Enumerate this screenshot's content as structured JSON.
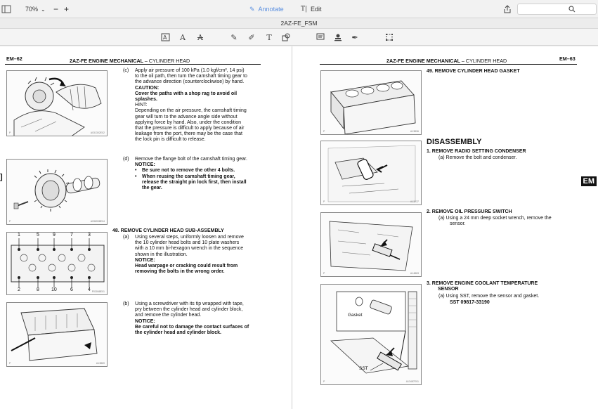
{
  "toolbar": {
    "zoom": "70%",
    "annotate_label": "Annotate",
    "edit_label": "Edit",
    "search_placeholder": ""
  },
  "document": {
    "title": "2AZ-FE_FSM"
  },
  "left_page": {
    "page_id": "EM–62",
    "header": "2AZ-FE ENGINE MECHANICAL",
    "header_sub": "CYLINDER HEAD",
    "fig1_code": "A031302E02",
    "fig2_code": "A036908E04",
    "fig3_code": "P03068E01",
    "fig4_code": "A13869",
    "c_step": {
      "label": "(c)",
      "lines": [
        "Apply air pressure of 100 kPa (1.0 kgf/cm², 14 psi)",
        "to the oil path, then turn the camshaft timing gear to",
        "the advance direction (counterclockwise) by hand."
      ],
      "caution_title": "CAUTION:",
      "caution_lines": [
        "Cover the paths with a shop rag to avoid oil",
        "splashes."
      ],
      "hint_title": "HINT:",
      "hint_lines": [
        "Depending on the air pressure, the camshaft timing",
        "gear will turn to the advance angle side without",
        "applying force by hand. Also, under the condition",
        "that the pressure is difficult to apply because of air",
        "leakage from the port, there may be the case that",
        "the lock pin is difficult to release."
      ]
    },
    "d_step": {
      "label": "(d)",
      "line": "Remove the flange bolt of the camshaft timing gear.",
      "notice_title": "NOTICE:",
      "bullet1": "Be sure not to remove the other 4 bolts.",
      "bullet2_lines": [
        "When reusing the camshaft timing gear,",
        "release the straight pin lock first, then install",
        "the gear."
      ]
    },
    "step48": {
      "title": "48.  REMOVE CYLINDER HEAD SUB-ASSEMBLY",
      "a_label": "(a)",
      "a_lines": [
        "Using several steps, uniformly loosen and remove",
        "the 10 cylinder head bolts and 10 plate washers",
        "with a 10 mm bi-hexagon wrench in the sequence",
        "shown in the illustration."
      ],
      "a_notice_title": "NOTICE:",
      "a_notice_lines": [
        "Head warpage or cracking could result from",
        "removing the bolts in the wrong order."
      ],
      "b_label": "(b)",
      "b_lines": [
        "Using a screwdriver with its tip wrapped with tape,",
        "pry between the cylinder head and cylinder block,",
        "and remove the cylinder head."
      ],
      "b_notice_title": "NOTICE:",
      "b_notice_lines": [
        "Be careful not to damage the contact surfaces of",
        "the cylinder head and cylinder block."
      ]
    },
    "bolt_top": [
      "1",
      "5",
      "9",
      "7",
      "3"
    ],
    "bolt_bottom": [
      "2",
      "8",
      "10",
      "6",
      "4"
    ]
  },
  "right_page": {
    "page_id": "EM–63",
    "header": "2AZ-FE ENGINE MECHANICAL",
    "header_sub": "CYLINDER HEAD",
    "step49": "49.  REMOVE CYLINDER HEAD GASKET",
    "disassembly": "DISASSEMBLY",
    "s1_title": "1.   REMOVE RADIO SETTING CONDENSER",
    "s1_a": "(a)   Remove the bolt and condenser.",
    "s2_title": "2.   REMOVE OIL PRESSURE SWITCH",
    "s2_a_lines": [
      "(a)   Using a 24 mm deep socket wrench, remove the",
      "sensor."
    ],
    "s3_title_lines": [
      "3.   REMOVE ENGINE COOLANT TEMPERATURE",
      "SENSOR"
    ],
    "s3_a": "(a)   Using SST, remove the sensor and gasket.",
    "s3_sst": "SST    09817-33190",
    "fig_gasket": "Gasket",
    "fig_sst": "SST",
    "fig1_code": "A13896",
    "fig2_code": "A13237",
    "fig3_code": "A14863",
    "fig4_code": "A13487E01",
    "em_tab": "EM"
  },
  "left_edge_mark": "]"
}
